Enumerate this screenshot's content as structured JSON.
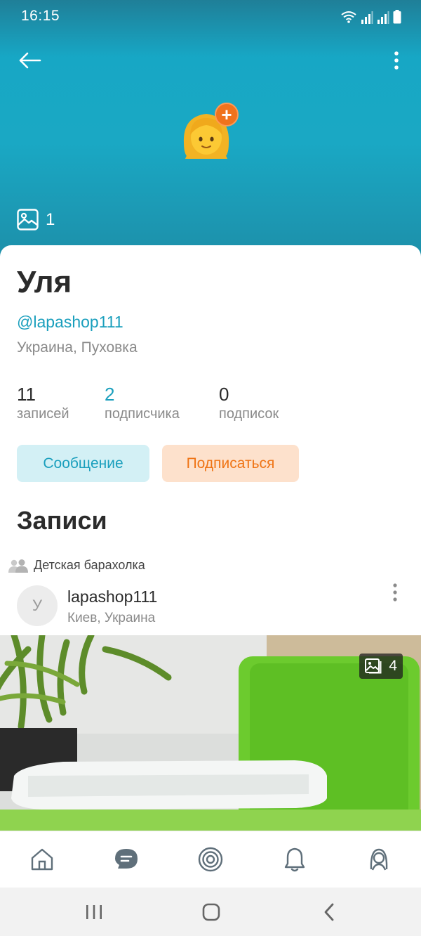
{
  "status_bar": {
    "time": "16:15"
  },
  "header": {
    "avatar_emoji": "👱‍♀️",
    "add_badge": "+",
    "photo_count": "1"
  },
  "profile": {
    "name": "Уля",
    "handle": "@lapashop111",
    "location": "Украина, Пуховка",
    "stats": [
      {
        "value": "11",
        "label": "записей"
      },
      {
        "value": "2",
        "label": "подписчика"
      },
      {
        "value": "0",
        "label": "подписок"
      }
    ],
    "message_label": "Сообщение",
    "subscribe_label": "Подписаться"
  },
  "posts_section": {
    "title": "Записи"
  },
  "post": {
    "group": "Детская барахолка",
    "avatar_letter": "У",
    "author": "lapashop111",
    "location": "Киев, Украина",
    "image_count": "4"
  },
  "bottom_nav": [
    "home-icon",
    "chat-icon",
    "target-icon",
    "bell-icon",
    "profile-icon"
  ],
  "colors": {
    "accent": "#1a9fbd",
    "orange": "#ef7415",
    "header_teal": "#17a7c5"
  }
}
